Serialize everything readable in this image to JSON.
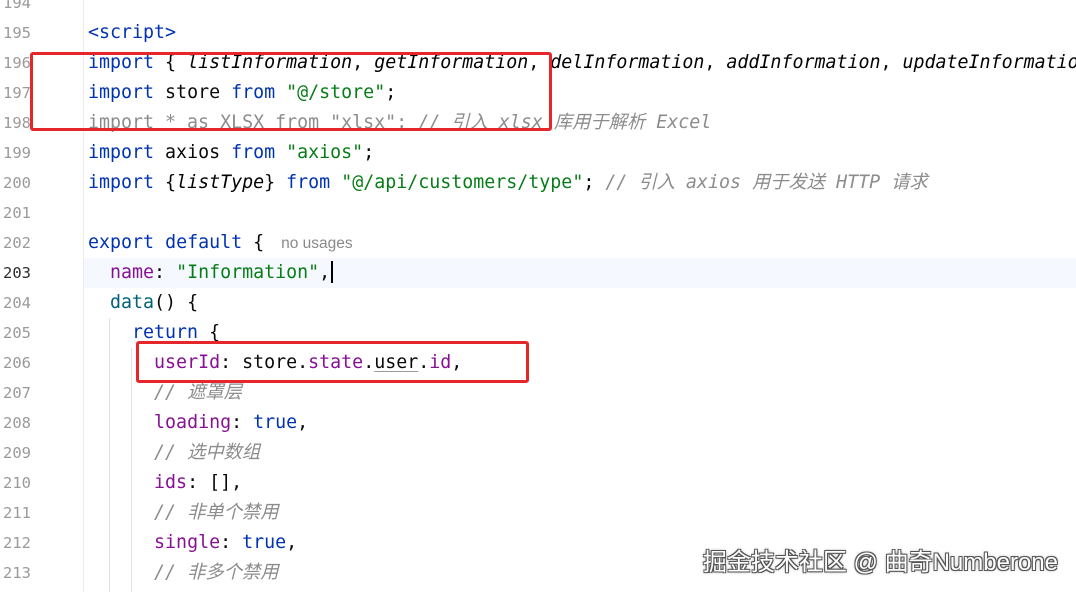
{
  "colors": {
    "keyword": "#0033b3",
    "string": "#067d17",
    "comment": "#8c8c8c",
    "property": "#871094",
    "method": "#00627a",
    "plain": "#080808",
    "current_line": "#f5f8fe",
    "annotation": "#e5262b"
  },
  "editor": {
    "current_line": "203",
    "lines": [
      {
        "number": "194",
        "tokens": []
      },
      {
        "number": "195",
        "tokens": [
          {
            "text": "<script>",
            "kind": "tag"
          }
        ]
      },
      {
        "number": "196",
        "tokens": [
          {
            "text": "import",
            "kind": "keyword"
          },
          {
            "text": " { ",
            "kind": "plain"
          },
          {
            "text": "listInformation",
            "kind": "import"
          },
          {
            "text": ", ",
            "kind": "plain"
          },
          {
            "text": "getInformation",
            "kind": "import"
          },
          {
            "text": ", ",
            "kind": "plain"
          },
          {
            "text": "delInformation",
            "kind": "import"
          },
          {
            "text": ", ",
            "kind": "plain"
          },
          {
            "text": "addInformation",
            "kind": "import"
          },
          {
            "text": ", ",
            "kind": "plain"
          },
          {
            "text": "updateInformatio",
            "kind": "import"
          }
        ]
      },
      {
        "number": "197",
        "tokens": [
          {
            "text": "import",
            "kind": "keyword"
          },
          {
            "text": " store ",
            "kind": "plain"
          },
          {
            "text": "from",
            "kind": "keyword"
          },
          {
            "text": " ",
            "kind": "plain"
          },
          {
            "text": "\"@/store\"",
            "kind": "string"
          },
          {
            "text": ";",
            "kind": "plain"
          }
        ]
      },
      {
        "number": "198",
        "tokens": [
          {
            "text": "import * as XLSX from \"xlsx\";",
            "kind": "unused"
          },
          {
            "text": " ",
            "kind": "plain"
          },
          {
            "text": "// 引入 xlsx 库用于解析 Excel",
            "kind": "comment"
          }
        ]
      },
      {
        "number": "199",
        "tokens": [
          {
            "text": "import",
            "kind": "keyword"
          },
          {
            "text": " axios ",
            "kind": "plain"
          },
          {
            "text": "from",
            "kind": "keyword"
          },
          {
            "text": " ",
            "kind": "plain"
          },
          {
            "text": "\"axios\"",
            "kind": "string"
          },
          {
            "text": ";",
            "kind": "plain"
          }
        ]
      },
      {
        "number": "200",
        "tokens": [
          {
            "text": "import",
            "kind": "keyword"
          },
          {
            "text": " {",
            "kind": "plain"
          },
          {
            "text": "listType",
            "kind": "import"
          },
          {
            "text": "} ",
            "kind": "plain"
          },
          {
            "text": "from",
            "kind": "keyword"
          },
          {
            "text": " ",
            "kind": "plain"
          },
          {
            "text": "\"@/api/customers/type\"",
            "kind": "string"
          },
          {
            "text": "; ",
            "kind": "plain"
          },
          {
            "text": "// 引入 axios 用于发送 HTTP 请求",
            "kind": "comment"
          }
        ]
      },
      {
        "number": "201",
        "tokens": []
      },
      {
        "number": "202",
        "tokens": [
          {
            "text": "export",
            "kind": "keyword"
          },
          {
            "text": " ",
            "kind": "plain"
          },
          {
            "text": "default",
            "kind": "keyword"
          },
          {
            "text": " {",
            "kind": "plain"
          },
          {
            "text": "no usages",
            "kind": "inlay"
          }
        ]
      },
      {
        "number": "203",
        "tokens": [
          {
            "text": "  ",
            "kind": "plain"
          },
          {
            "text": "name",
            "kind": "prop"
          },
          {
            "text": ": ",
            "kind": "plain"
          },
          {
            "text": "\"Information\"",
            "kind": "string"
          },
          {
            "text": ",",
            "kind": "plain"
          }
        ]
      },
      {
        "number": "204",
        "tokens": [
          {
            "text": "  ",
            "kind": "plain"
          },
          {
            "text": "data",
            "kind": "method"
          },
          {
            "text": "() {",
            "kind": "plain"
          }
        ]
      },
      {
        "number": "205",
        "tokens": [
          {
            "text": "    ",
            "kind": "plain"
          },
          {
            "text": "return",
            "kind": "keyword"
          },
          {
            "text": " {",
            "kind": "plain"
          }
        ]
      },
      {
        "number": "206",
        "tokens": [
          {
            "text": "      ",
            "kind": "plain"
          },
          {
            "text": "userId",
            "kind": "prop"
          },
          {
            "text": ": ",
            "kind": "plain"
          },
          {
            "text": "store",
            "kind": "plain"
          },
          {
            "text": ".",
            "kind": "plain"
          },
          {
            "text": "state",
            "kind": "prop"
          },
          {
            "text": ".",
            "kind": "plain"
          },
          {
            "text": "user",
            "kind": "weak"
          },
          {
            "text": ".",
            "kind": "plain"
          },
          {
            "text": "id",
            "kind": "prop"
          },
          {
            "text": ",",
            "kind": "plain"
          }
        ]
      },
      {
        "number": "207",
        "tokens": [
          {
            "text": "      ",
            "kind": "plain"
          },
          {
            "text": "// 遮罩层",
            "kind": "comment"
          }
        ]
      },
      {
        "number": "208",
        "tokens": [
          {
            "text": "      ",
            "kind": "plain"
          },
          {
            "text": "loading",
            "kind": "prop"
          },
          {
            "text": ": ",
            "kind": "plain"
          },
          {
            "text": "true",
            "kind": "keyword"
          },
          {
            "text": ",",
            "kind": "plain"
          }
        ]
      },
      {
        "number": "209",
        "tokens": [
          {
            "text": "      ",
            "kind": "plain"
          },
          {
            "text": "// 选中数组",
            "kind": "comment"
          }
        ]
      },
      {
        "number": "210",
        "tokens": [
          {
            "text": "      ",
            "kind": "plain"
          },
          {
            "text": "ids",
            "kind": "prop"
          },
          {
            "text": ": [],",
            "kind": "plain"
          }
        ]
      },
      {
        "number": "211",
        "tokens": [
          {
            "text": "      ",
            "kind": "plain"
          },
          {
            "text": "// 非单个禁用",
            "kind": "comment"
          }
        ]
      },
      {
        "number": "212",
        "tokens": [
          {
            "text": "      ",
            "kind": "plain"
          },
          {
            "text": "single",
            "kind": "prop"
          },
          {
            "text": ": ",
            "kind": "plain"
          },
          {
            "text": "true",
            "kind": "keyword"
          },
          {
            "text": ",",
            "kind": "plain"
          }
        ]
      },
      {
        "number": "213",
        "tokens": [
          {
            "text": "      ",
            "kind": "plain"
          },
          {
            "text": "// 非多个禁用",
            "kind": "comment"
          }
        ]
      }
    ]
  },
  "watermark": {
    "text": "掘金技术社区 @ 曲奇Numberone"
  }
}
